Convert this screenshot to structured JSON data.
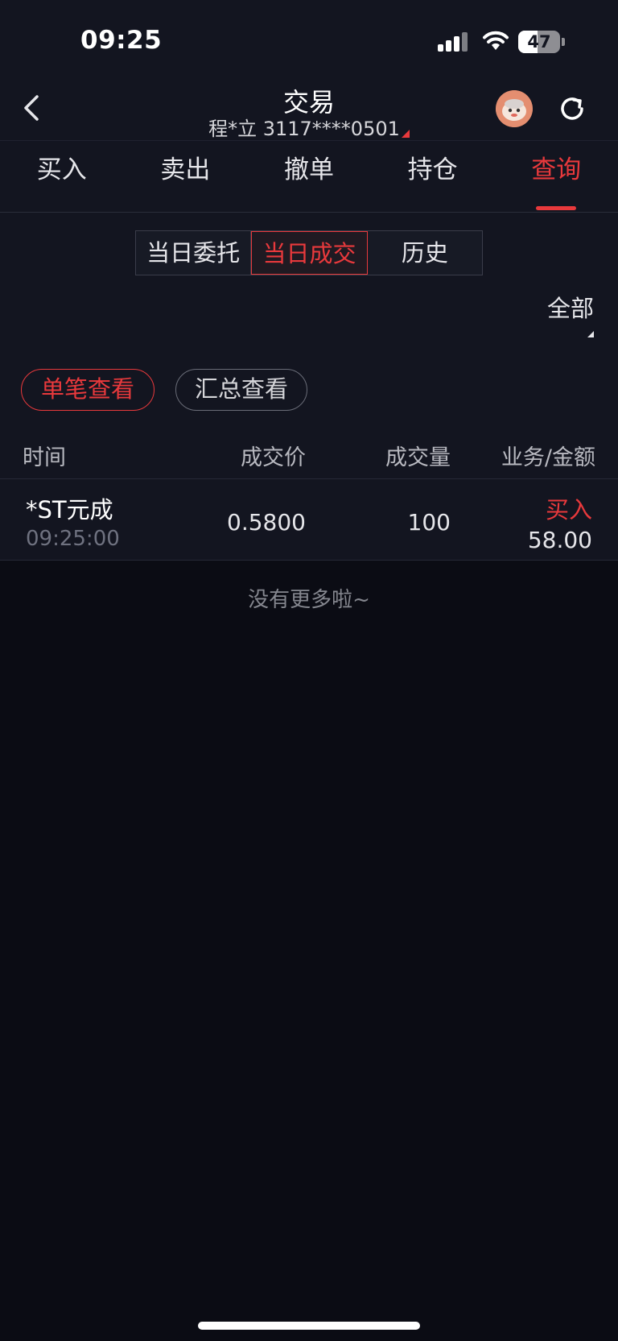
{
  "status_bar": {
    "time": "09:25",
    "battery_level": "47",
    "battery_fraction": 0.47
  },
  "header": {
    "title": "交易",
    "account": "程*立 3117****0501"
  },
  "tabs": [
    {
      "label": "买入",
      "active": false
    },
    {
      "label": "卖出",
      "active": false
    },
    {
      "label": "撤单",
      "active": false
    },
    {
      "label": "持仓",
      "active": false
    },
    {
      "label": "查询",
      "active": true
    }
  ],
  "segment": [
    {
      "label": "当日委托",
      "active": false
    },
    {
      "label": "当日成交",
      "active": true
    },
    {
      "label": "历史",
      "active": false
    }
  ],
  "filter": {
    "label": "全部"
  },
  "view_mode": {
    "single": "单笔查看",
    "summary": "汇总查看"
  },
  "table": {
    "headers": {
      "time": "时间",
      "price": "成交价",
      "volume": "成交量",
      "business_amount": "业务/金额"
    },
    "rows": [
      {
        "name": "*ST元成",
        "time": "09:25:00",
        "price": "0.5800",
        "volume": "100",
        "business": "买入",
        "amount": "58.00"
      }
    ]
  },
  "footer_text": "没有更多啦~",
  "colors": {
    "accent": "#e8393c",
    "background": "#0b0c14",
    "panel": "#131520"
  }
}
